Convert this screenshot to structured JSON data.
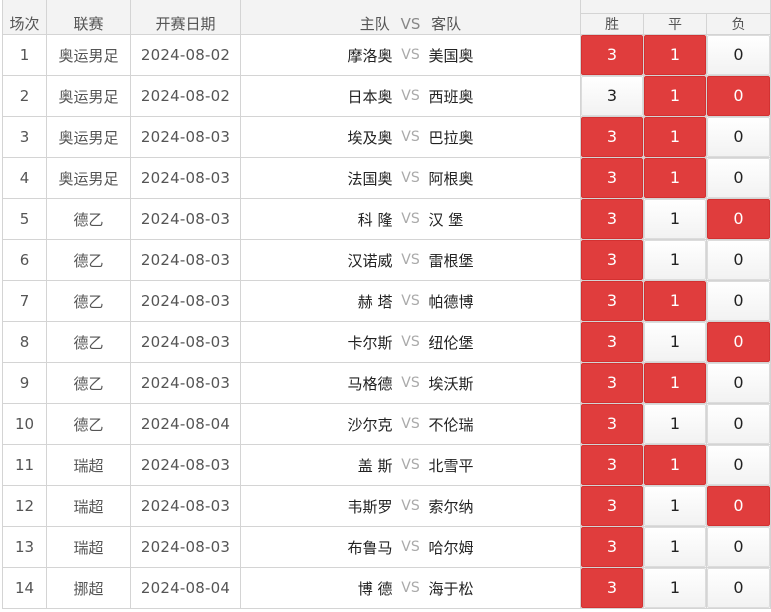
{
  "header": {
    "no": "场次",
    "league": "联赛",
    "date": "开赛日期",
    "home": "主队",
    "vs": "VS",
    "away": "客队",
    "win": "胜",
    "draw": "平",
    "lose": "负"
  },
  "colors": {
    "selected": "#e03d3d",
    "border": "#d4d4d4"
  },
  "rows": [
    {
      "no": "1",
      "league": "奥运男足",
      "date": "2024-08-02",
      "home": "摩洛奥",
      "vs": "VS",
      "away": "美国奥",
      "win": "3",
      "draw": "1",
      "lose": "0",
      "sel": [
        true,
        true,
        false
      ]
    },
    {
      "no": "2",
      "league": "奥运男足",
      "date": "2024-08-02",
      "home": "日本奥",
      "vs": "VS",
      "away": "西班奥",
      "win": "3",
      "draw": "1",
      "lose": "0",
      "sel": [
        false,
        true,
        true
      ]
    },
    {
      "no": "3",
      "league": "奥运男足",
      "date": "2024-08-03",
      "home": "埃及奥",
      "vs": "VS",
      "away": "巴拉奥",
      "win": "3",
      "draw": "1",
      "lose": "0",
      "sel": [
        true,
        true,
        false
      ]
    },
    {
      "no": "4",
      "league": "奥运男足",
      "date": "2024-08-03",
      "home": "法国奥",
      "vs": "VS",
      "away": "阿根奥",
      "win": "3",
      "draw": "1",
      "lose": "0",
      "sel": [
        true,
        true,
        false
      ]
    },
    {
      "no": "5",
      "league": "德乙",
      "date": "2024-08-03",
      "home": "科 隆",
      "vs": "VS",
      "away": "汉 堡",
      "win": "3",
      "draw": "1",
      "lose": "0",
      "sel": [
        true,
        false,
        true
      ]
    },
    {
      "no": "6",
      "league": "德乙",
      "date": "2024-08-03",
      "home": "汉诺威",
      "vs": "VS",
      "away": "雷根堡",
      "win": "3",
      "draw": "1",
      "lose": "0",
      "sel": [
        true,
        false,
        false
      ]
    },
    {
      "no": "7",
      "league": "德乙",
      "date": "2024-08-03",
      "home": "赫 塔",
      "vs": "VS",
      "away": "帕德博",
      "win": "3",
      "draw": "1",
      "lose": "0",
      "sel": [
        true,
        true,
        false
      ]
    },
    {
      "no": "8",
      "league": "德乙",
      "date": "2024-08-03",
      "home": "卡尔斯",
      "vs": "VS",
      "away": "纽伦堡",
      "win": "3",
      "draw": "1",
      "lose": "0",
      "sel": [
        true,
        false,
        true
      ]
    },
    {
      "no": "9",
      "league": "德乙",
      "date": "2024-08-03",
      "home": "马格德",
      "vs": "VS",
      "away": "埃沃斯",
      "win": "3",
      "draw": "1",
      "lose": "0",
      "sel": [
        true,
        true,
        false
      ]
    },
    {
      "no": "10",
      "league": "德乙",
      "date": "2024-08-04",
      "home": "沙尔克",
      "vs": "VS",
      "away": "不伦瑞",
      "win": "3",
      "draw": "1",
      "lose": "0",
      "sel": [
        true,
        false,
        false
      ]
    },
    {
      "no": "11",
      "league": "瑞超",
      "date": "2024-08-03",
      "home": "盖 斯",
      "vs": "VS",
      "away": "北雪平",
      "win": "3",
      "draw": "1",
      "lose": "0",
      "sel": [
        true,
        true,
        false
      ]
    },
    {
      "no": "12",
      "league": "瑞超",
      "date": "2024-08-03",
      "home": "韦斯罗",
      "vs": "VS",
      "away": "索尔纳",
      "win": "3",
      "draw": "1",
      "lose": "0",
      "sel": [
        true,
        false,
        true
      ]
    },
    {
      "no": "13",
      "league": "瑞超",
      "date": "2024-08-03",
      "home": "布鲁马",
      "vs": "VS",
      "away": "哈尔姆",
      "win": "3",
      "draw": "1",
      "lose": "0",
      "sel": [
        true,
        false,
        false
      ]
    },
    {
      "no": "14",
      "league": "挪超",
      "date": "2024-08-04",
      "home": "博 德",
      "vs": "VS",
      "away": "海于松",
      "win": "3",
      "draw": "1",
      "lose": "0",
      "sel": [
        true,
        false,
        false
      ]
    }
  ]
}
